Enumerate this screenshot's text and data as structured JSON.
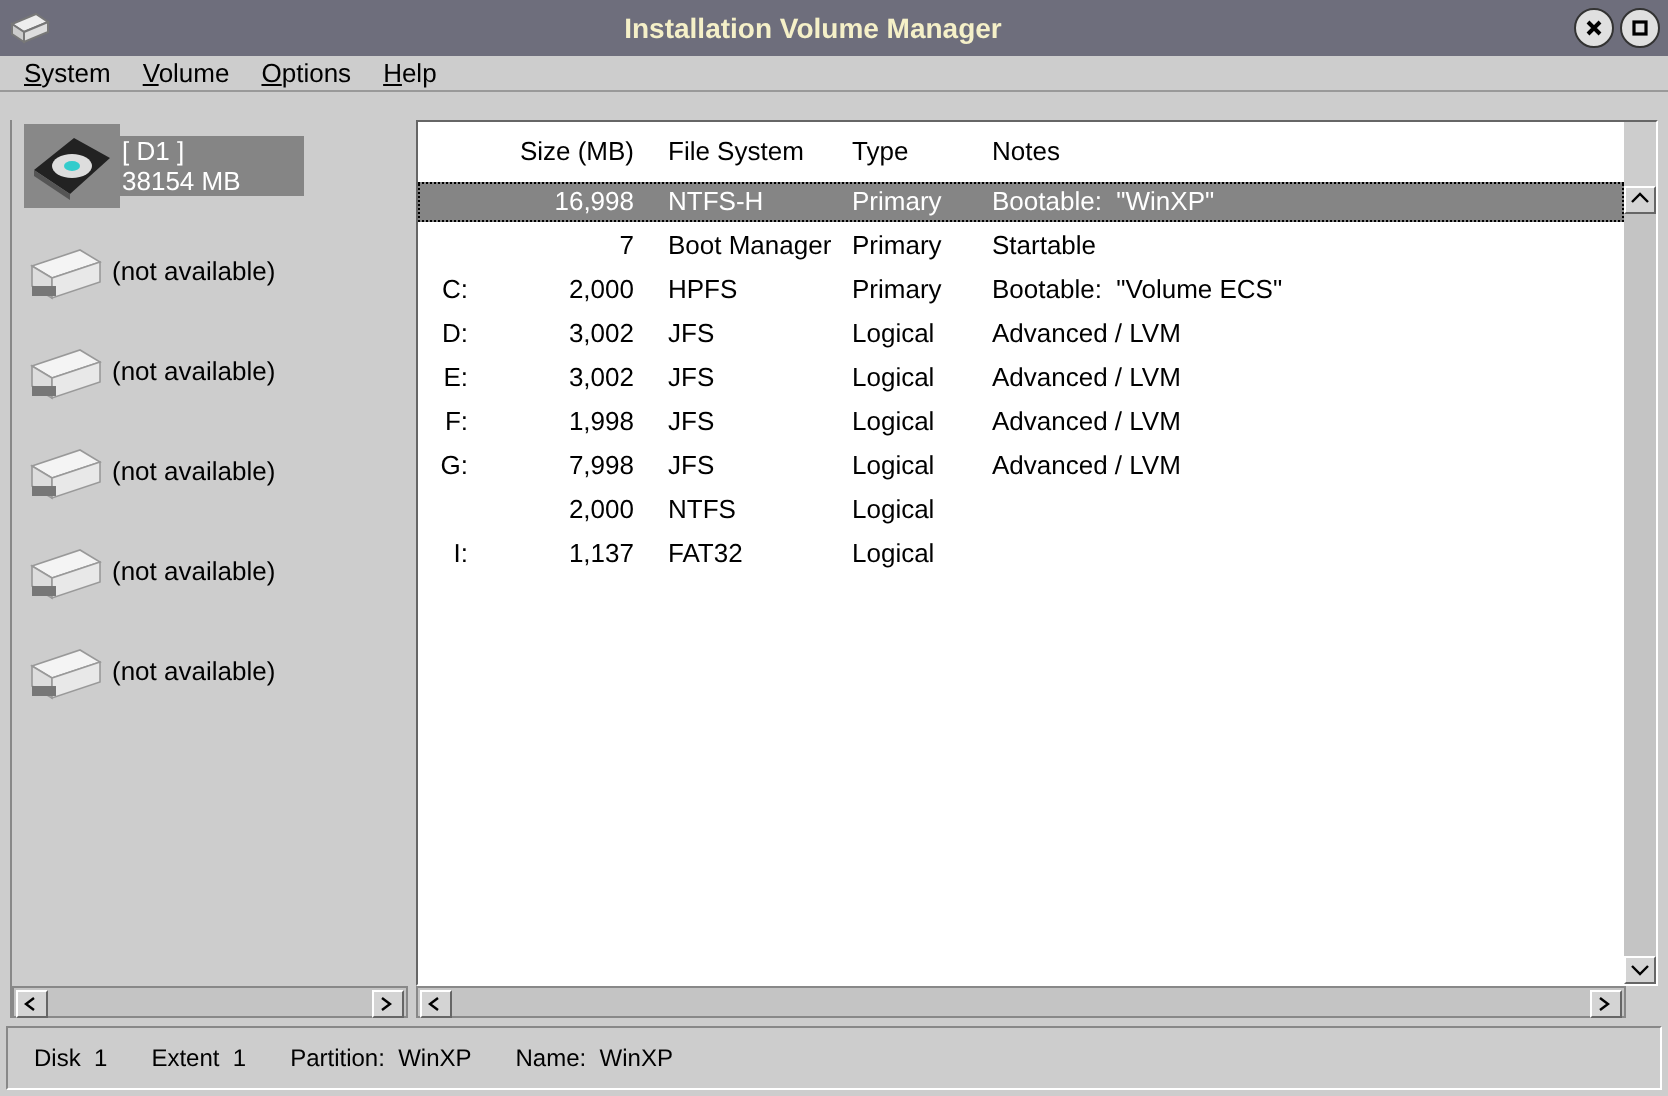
{
  "window": {
    "title": "Installation Volume Manager"
  },
  "menu": [
    "System",
    "Volume",
    "Options",
    "Help"
  ],
  "disks": [
    {
      "kind": "disk",
      "label": "[ D1 ]",
      "size": "38154 MB",
      "selected": true
    },
    {
      "kind": "unavailable",
      "label": "(not available)",
      "selected": false
    },
    {
      "kind": "unavailable",
      "label": "(not available)",
      "selected": false
    },
    {
      "kind": "unavailable",
      "label": "(not available)",
      "selected": false
    },
    {
      "kind": "unavailable",
      "label": "(not available)",
      "selected": false
    },
    {
      "kind": "unavailable",
      "label": "(not available)",
      "selected": false
    }
  ],
  "table": {
    "columns": [
      "Size (MB)",
      "File System",
      "Type",
      "Notes"
    ],
    "rows": [
      {
        "letter": "",
        "size": "16,998",
        "fs": "NTFS-H",
        "type": "Primary",
        "notes": "Bootable:  \"WinXP\"",
        "selected": true
      },
      {
        "letter": "",
        "size": "7",
        "fs": "Boot Manager",
        "type": "Primary",
        "notes": "Startable",
        "selected": false
      },
      {
        "letter": "C:",
        "size": "2,000",
        "fs": "HPFS",
        "type": "Primary",
        "notes": "Bootable:  \"Volume ECS\"",
        "selected": false
      },
      {
        "letter": "D:",
        "size": "3,002",
        "fs": "JFS",
        "type": "Logical",
        "notes": "Advanced / LVM",
        "selected": false
      },
      {
        "letter": "E:",
        "size": "3,002",
        "fs": "JFS",
        "type": "Logical",
        "notes": "Advanced / LVM",
        "selected": false
      },
      {
        "letter": "F:",
        "size": "1,998",
        "fs": "JFS",
        "type": "Logical",
        "notes": "Advanced / LVM",
        "selected": false
      },
      {
        "letter": "G:",
        "size": "7,998",
        "fs": "JFS",
        "type": "Logical",
        "notes": "Advanced / LVM",
        "selected": false
      },
      {
        "letter": "",
        "size": "2,000",
        "fs": "NTFS",
        "type": "Logical",
        "notes": "",
        "selected": false
      },
      {
        "letter": "I:",
        "size": "1,137",
        "fs": "FAT32",
        "type": "Logical",
        "notes": "",
        "selected": false
      }
    ]
  },
  "status_bar": [
    "Disk  1",
    "Extent  1",
    "Partition:  WinXP",
    "Name:  WinXP"
  ]
}
